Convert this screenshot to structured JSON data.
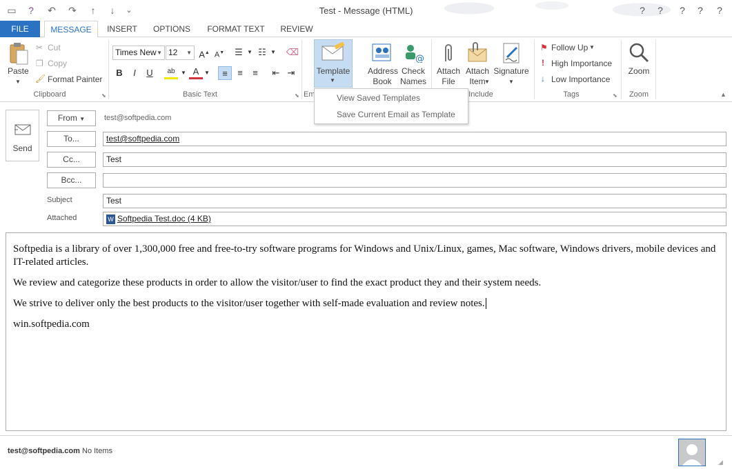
{
  "window": {
    "title": "Test - Message (HTML)",
    "minimize_glyph": "?",
    "restore_glyph": "?",
    "close_glyph": "?",
    "help_glyph": "?",
    "ribbon_display_glyph": "?"
  },
  "qat": {
    "menu_glyph": "▭",
    "save_glyph": "?",
    "undo_glyph": "↶",
    "redo_glyph": "↷",
    "up_glyph": "↑",
    "down_glyph": "↓",
    "customize_glyph": "⌄"
  },
  "tabs": [
    {
      "label": "FILE"
    },
    {
      "label": "MESSAGE"
    },
    {
      "label": "INSERT"
    },
    {
      "label": "OPTIONS"
    },
    {
      "label": "FORMAT TEXT"
    },
    {
      "label": "REVIEW"
    }
  ],
  "ribbon": {
    "clipboard": {
      "paste": "Paste",
      "cut": "Cut",
      "copy": "Copy",
      "format_painter": "Format Painter",
      "label": "Clipboard"
    },
    "basic_text": {
      "font_name": "Times New",
      "font_size": "12",
      "bold": "B",
      "italic": "I",
      "underline": "U",
      "label": "Basic Text"
    },
    "email_label": "Em",
    "template": {
      "label": "Template"
    },
    "names": {
      "address_book_1": "Address",
      "address_book_2": "Book",
      "check_names_1": "Check",
      "check_names_2": "Names"
    },
    "include": {
      "attach_file_1": "Attach",
      "attach_file_2": "File",
      "attach_item_1": "Attach",
      "attach_item_2": "Item",
      "signature": "Signature",
      "label": "Include"
    },
    "tags": {
      "follow_up": "Follow Up",
      "high_importance": "High Importance",
      "low_importance": "Low Importance",
      "label": "Tags"
    },
    "zoom": {
      "button": "Zoom",
      "label": "Zoom"
    }
  },
  "template_menu": {
    "items": [
      "View Saved Templates",
      "Save Current Email as Template"
    ]
  },
  "compose": {
    "send": "Send",
    "from_button": "From",
    "from_value": "test@softpedia.com",
    "to_button": "To...",
    "to_value": "test@softpedia.com",
    "cc_button": "Cc...",
    "cc_value": "Test",
    "bcc_button": "Bcc...",
    "bcc_value": "",
    "subject_label": "Subject",
    "subject_value": "Test",
    "attached_label": "Attached",
    "attachment": "Softpedia Test.doc (4 KB)"
  },
  "body": {
    "paragraphs": [
      "Softpedia is a library of over 1,300,000 free and free-to-try software programs for Windows and Unix/Linux, games, Mac software, Windows drivers, mobile devices and IT-related articles.",
      "We review and categorize these products in order to allow the visitor/user to find the exact product they and their system needs.",
      "We strive to deliver only the best products to the visitor/user together with self-made evaluation and review notes.",
      "win.softpedia.com"
    ]
  },
  "status": {
    "account": "test@softpedia.com",
    "items": "No Items"
  },
  "colors": {
    "accent": "#2b73c2",
    "template_highlight": "#c5dcf2",
    "high_importance": "#d13438",
    "low_importance": "#2b73c2"
  }
}
